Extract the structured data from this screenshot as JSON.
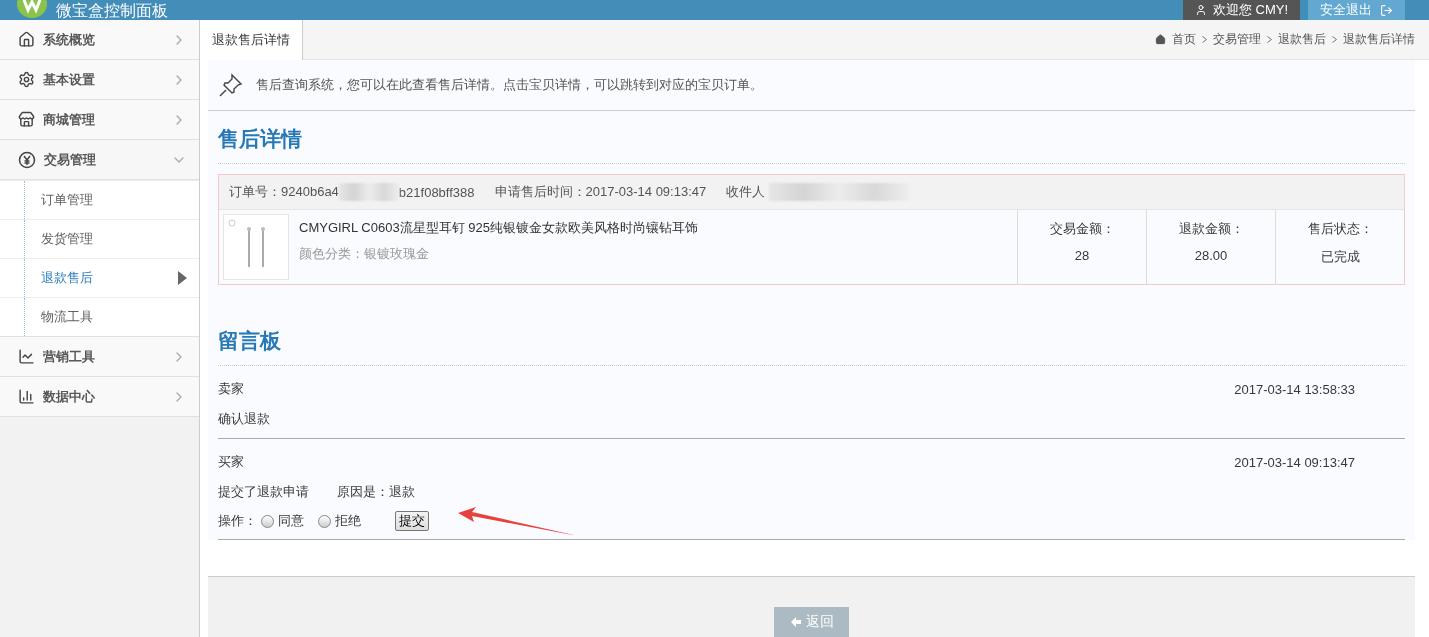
{
  "header": {
    "title": "微宝盒控制面板",
    "welcome": "欢迎您 CMY!",
    "logout": "安全退出"
  },
  "sidebar": {
    "items": [
      {
        "label": "系统概览",
        "expanded": false
      },
      {
        "label": "基本设置",
        "expanded": false
      },
      {
        "label": "商城管理",
        "expanded": false
      },
      {
        "label": "交易管理",
        "expanded": true,
        "children": [
          {
            "label": "订单管理",
            "selected": false
          },
          {
            "label": "发货管理",
            "selected": false
          },
          {
            "label": "退款售后",
            "selected": true
          },
          {
            "label": "物流工具",
            "selected": false
          }
        ]
      },
      {
        "label": "营销工具",
        "expanded": false
      },
      {
        "label": "数据中心",
        "expanded": false
      }
    ]
  },
  "tabs": [
    {
      "label": "退款售后详情",
      "selected": true
    }
  ],
  "breadcrumb": [
    "首页",
    "交易管理",
    "退款售后",
    "退款售后详情"
  ],
  "notice": "售后查询系统，您可以在此查看售后详情。点击宝贝详情，可以跳转到对应的宝贝订单。",
  "detail": {
    "heading": "售后详情",
    "order_label": "订单号：",
    "order_start": "9240b6a4",
    "order_end": "b21f08bff388",
    "apply_time": "申请售后时间：2017-03-14 09:13:47",
    "recipient_label": "收件人",
    "product": {
      "kind": "picture",
      "name": "CMYGIRL C0603流星型耳钉 925纯银镀金女款欧美风格时尚镶钻耳饰",
      "variant": "颜色分类：银镀玫瑰金"
    },
    "stats": [
      {
        "label": "交易金额：",
        "value": "28"
      },
      {
        "label": "退款金额：",
        "value": "28.00"
      },
      {
        "label": "售后状态：",
        "value": "已完成"
      }
    ]
  },
  "board": {
    "heading": "留言板",
    "messages": [
      {
        "author": "卖家",
        "time": "2017-03-14 13:58:33",
        "lines": [
          "确认退款"
        ]
      },
      {
        "author": "买家",
        "time": "2017-03-14 09:13:47",
        "lines": [
          "提交了退款申请",
          "原因是：退款"
        ],
        "action": {
          "label": "操作：",
          "options": [
            {
              "label": "同意",
              "selected": false
            },
            {
              "label": "拒绝",
              "selected": false
            }
          ],
          "submit": "提交"
        }
      }
    ]
  },
  "back_button": "返回"
}
